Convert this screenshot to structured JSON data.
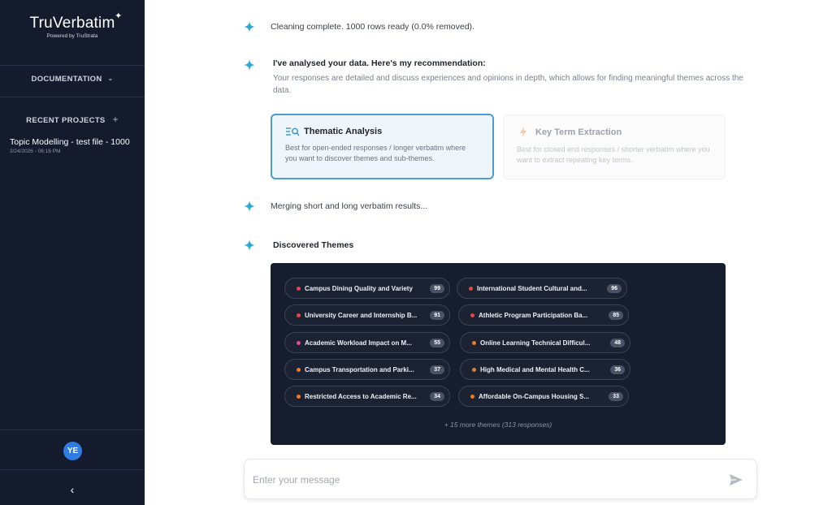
{
  "sidebar": {
    "logo": "TruVerbatim",
    "logo_star": "✦",
    "logo_sub": "Powered by TruStrata",
    "documentation": "DOCUMENTATION",
    "recent_projects": "RECENT PROJECTS",
    "add_icon": "+",
    "projects": [
      {
        "title": "Topic Modelling - test file - 1000",
        "date": "3/24/2026 - 06:16 PM"
      }
    ],
    "avatar": "YE",
    "collapse_icon": "‹"
  },
  "chat": {
    "cleaning": "Cleaning complete. 1000 rows ready (0.0% removed).",
    "recommendation_title": "I've analysed your data. Here's my recommendation:",
    "recommendation_text": "Your responses are detailed and discuss experiences and opinions in depth, which allows for finding meaningful themes across the data.",
    "options": [
      {
        "title": "Thematic Analysis",
        "desc": "Best for open-ended responses / longer verbatim where you want to discover themes and sub-themes.",
        "icon": "thematic-search-icon",
        "selected": true
      },
      {
        "title": "Key Term Extraction",
        "desc": "Best for closed end responses / shorter verbatim where you want to extract repeating key terms.",
        "icon": "lightning-icon",
        "selected": false
      }
    ],
    "merging": "Merging short and long verbatim results...",
    "themes_title": "Discovered Themes",
    "themes": [
      {
        "label": "Campus Dining Quality and Variety",
        "count": "99",
        "color": "#e84545"
      },
      {
        "label": "International Student Cultural and...",
        "count": "96",
        "color": "#e84545"
      },
      {
        "label": "University Career and Internship B...",
        "count": "91",
        "color": "#e84545"
      },
      {
        "label": "Athletic Program Participation Ba...",
        "count": "85",
        "color": "#e84545"
      },
      {
        "label": "Academic Workload Impact on M...",
        "count": "55",
        "color": "#e0489a"
      },
      {
        "label": "Online Learning Technical Difficul...",
        "count": "48",
        "color": "#f07a22"
      },
      {
        "label": "Campus Transportation and Parki...",
        "count": "37",
        "color": "#f07a22"
      },
      {
        "label": "High Medical and Mental Health C...",
        "count": "36",
        "color": "#f07a22"
      },
      {
        "label": "Restricted Access to Academic Re...",
        "count": "34",
        "color": "#f07a22"
      },
      {
        "label": "Affordable On-Campus Housing S...",
        "count": "33",
        "color": "#f07a22"
      }
    ],
    "more_themes": "+ 15 more themes (313 responses)"
  },
  "input": {
    "placeholder": "Enter your message"
  },
  "colors": {
    "sidebar_bg": "#141b2d",
    "accent": "#2aa6d9",
    "selected_border": "#4a9bd6",
    "themes_bg": "#161d2c"
  }
}
